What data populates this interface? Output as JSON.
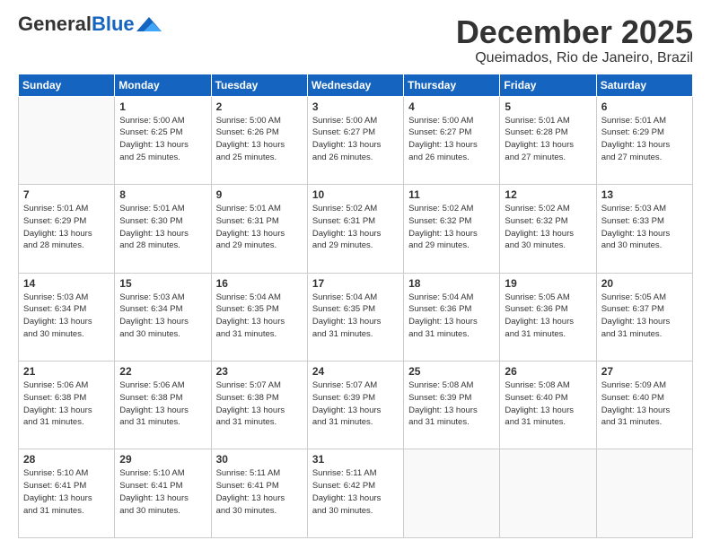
{
  "header": {
    "logo_general": "General",
    "logo_blue": "Blue",
    "month_title": "December 2025",
    "subtitle": "Queimados, Rio de Janeiro, Brazil"
  },
  "calendar": {
    "days_of_week": [
      "Sunday",
      "Monday",
      "Tuesday",
      "Wednesday",
      "Thursday",
      "Friday",
      "Saturday"
    ],
    "weeks": [
      [
        {
          "day": "",
          "info": ""
        },
        {
          "day": "1",
          "info": "Sunrise: 5:00 AM\nSunset: 6:25 PM\nDaylight: 13 hours\nand 25 minutes."
        },
        {
          "day": "2",
          "info": "Sunrise: 5:00 AM\nSunset: 6:26 PM\nDaylight: 13 hours\nand 25 minutes."
        },
        {
          "day": "3",
          "info": "Sunrise: 5:00 AM\nSunset: 6:27 PM\nDaylight: 13 hours\nand 26 minutes."
        },
        {
          "day": "4",
          "info": "Sunrise: 5:00 AM\nSunset: 6:27 PM\nDaylight: 13 hours\nand 26 minutes."
        },
        {
          "day": "5",
          "info": "Sunrise: 5:01 AM\nSunset: 6:28 PM\nDaylight: 13 hours\nand 27 minutes."
        },
        {
          "day": "6",
          "info": "Sunrise: 5:01 AM\nSunset: 6:29 PM\nDaylight: 13 hours\nand 27 minutes."
        }
      ],
      [
        {
          "day": "7",
          "info": "Sunrise: 5:01 AM\nSunset: 6:29 PM\nDaylight: 13 hours\nand 28 minutes."
        },
        {
          "day": "8",
          "info": "Sunrise: 5:01 AM\nSunset: 6:30 PM\nDaylight: 13 hours\nand 28 minutes."
        },
        {
          "day": "9",
          "info": "Sunrise: 5:01 AM\nSunset: 6:31 PM\nDaylight: 13 hours\nand 29 minutes."
        },
        {
          "day": "10",
          "info": "Sunrise: 5:02 AM\nSunset: 6:31 PM\nDaylight: 13 hours\nand 29 minutes."
        },
        {
          "day": "11",
          "info": "Sunrise: 5:02 AM\nSunset: 6:32 PM\nDaylight: 13 hours\nand 29 minutes."
        },
        {
          "day": "12",
          "info": "Sunrise: 5:02 AM\nSunset: 6:32 PM\nDaylight: 13 hours\nand 30 minutes."
        },
        {
          "day": "13",
          "info": "Sunrise: 5:03 AM\nSunset: 6:33 PM\nDaylight: 13 hours\nand 30 minutes."
        }
      ],
      [
        {
          "day": "14",
          "info": "Sunrise: 5:03 AM\nSunset: 6:34 PM\nDaylight: 13 hours\nand 30 minutes."
        },
        {
          "day": "15",
          "info": "Sunrise: 5:03 AM\nSunset: 6:34 PM\nDaylight: 13 hours\nand 30 minutes."
        },
        {
          "day": "16",
          "info": "Sunrise: 5:04 AM\nSunset: 6:35 PM\nDaylight: 13 hours\nand 31 minutes."
        },
        {
          "day": "17",
          "info": "Sunrise: 5:04 AM\nSunset: 6:35 PM\nDaylight: 13 hours\nand 31 minutes."
        },
        {
          "day": "18",
          "info": "Sunrise: 5:04 AM\nSunset: 6:36 PM\nDaylight: 13 hours\nand 31 minutes."
        },
        {
          "day": "19",
          "info": "Sunrise: 5:05 AM\nSunset: 6:36 PM\nDaylight: 13 hours\nand 31 minutes."
        },
        {
          "day": "20",
          "info": "Sunrise: 5:05 AM\nSunset: 6:37 PM\nDaylight: 13 hours\nand 31 minutes."
        }
      ],
      [
        {
          "day": "21",
          "info": "Sunrise: 5:06 AM\nSunset: 6:38 PM\nDaylight: 13 hours\nand 31 minutes."
        },
        {
          "day": "22",
          "info": "Sunrise: 5:06 AM\nSunset: 6:38 PM\nDaylight: 13 hours\nand 31 minutes."
        },
        {
          "day": "23",
          "info": "Sunrise: 5:07 AM\nSunset: 6:38 PM\nDaylight: 13 hours\nand 31 minutes."
        },
        {
          "day": "24",
          "info": "Sunrise: 5:07 AM\nSunset: 6:39 PM\nDaylight: 13 hours\nand 31 minutes."
        },
        {
          "day": "25",
          "info": "Sunrise: 5:08 AM\nSunset: 6:39 PM\nDaylight: 13 hours\nand 31 minutes."
        },
        {
          "day": "26",
          "info": "Sunrise: 5:08 AM\nSunset: 6:40 PM\nDaylight: 13 hours\nand 31 minutes."
        },
        {
          "day": "27",
          "info": "Sunrise: 5:09 AM\nSunset: 6:40 PM\nDaylight: 13 hours\nand 31 minutes."
        }
      ],
      [
        {
          "day": "28",
          "info": "Sunrise: 5:10 AM\nSunset: 6:41 PM\nDaylight: 13 hours\nand 31 minutes."
        },
        {
          "day": "29",
          "info": "Sunrise: 5:10 AM\nSunset: 6:41 PM\nDaylight: 13 hours\nand 30 minutes."
        },
        {
          "day": "30",
          "info": "Sunrise: 5:11 AM\nSunset: 6:41 PM\nDaylight: 13 hours\nand 30 minutes."
        },
        {
          "day": "31",
          "info": "Sunrise: 5:11 AM\nSunset: 6:42 PM\nDaylight: 13 hours\nand 30 minutes."
        },
        {
          "day": "",
          "info": ""
        },
        {
          "day": "",
          "info": ""
        },
        {
          "day": "",
          "info": ""
        }
      ]
    ]
  }
}
